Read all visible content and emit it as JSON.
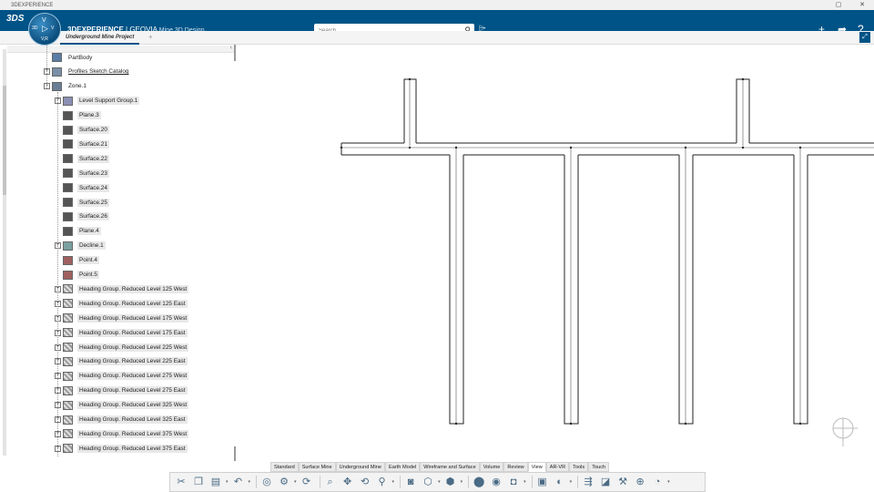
{
  "window": {
    "title": "3DEXPERIENCE"
  },
  "appbar": {
    "brand": "3DEXPERIENCE",
    "app": "GEOVIA",
    "app_sub": "Mine 3D Design",
    "compass": {
      "top": "V",
      "left": "3D",
      "right": "V",
      "bottom": "V,R"
    },
    "search_placeholder": "Search"
  },
  "tabs": {
    "project": "Underground Mine Project"
  },
  "tree": [
    {
      "label": "PartBody",
      "indent": 1
    },
    {
      "label": "Profiles Sketch Catalog",
      "indent": 1
    },
    {
      "label": "Zone.1",
      "indent": 1
    },
    {
      "label": "Level Support Group.1",
      "indent": 2
    },
    {
      "label": "Plane.3",
      "indent": 2
    },
    {
      "label": "Surface.20",
      "indent": 2
    },
    {
      "label": "Surface.21",
      "indent": 2
    },
    {
      "label": "Surface.22",
      "indent": 2
    },
    {
      "label": "Surface.23",
      "indent": 2
    },
    {
      "label": "Surface.24",
      "indent": 2
    },
    {
      "label": "Surface.25",
      "indent": 2
    },
    {
      "label": "Surface.26",
      "indent": 2
    },
    {
      "label": "Plane.4",
      "indent": 2
    },
    {
      "label": "Decline.1",
      "indent": 2
    },
    {
      "label": "Point.4",
      "indent": 2
    },
    {
      "label": "Point.5",
      "indent": 2
    },
    {
      "label": "Heading Group. Reduced Level 125 West",
      "indent": 2
    },
    {
      "label": "Heading Group. Reduced Level 125 East",
      "indent": 2
    },
    {
      "label": "Heading Group. Reduced Level 175 West",
      "indent": 2
    },
    {
      "label": "Heading Group. Reduced Level 175 East",
      "indent": 2
    },
    {
      "label": "Heading Group. Reduced Level 225 West",
      "indent": 2
    },
    {
      "label": "Heading Group. Reduced Level 225 East",
      "indent": 2
    },
    {
      "label": "Heading Group. Reduced Level 275 West",
      "indent": 2
    },
    {
      "label": "Heading Group. Reduced Level 275 East",
      "indent": 2
    },
    {
      "label": "Heading Group. Reduced Level 325 West",
      "indent": 2
    },
    {
      "label": "Heading Group. Reduced Level 325 East",
      "indent": 2
    },
    {
      "label": "Heading Group. Reduced Level 375 West",
      "indent": 2
    },
    {
      "label": "Heading Group. Reduced Level 375 East",
      "indent": 2
    }
  ],
  "command_tabs": [
    "Standard",
    "Surface Mine",
    "Underground Mine",
    "Earth Model",
    "Wireframe and Surface",
    "Volume",
    "Review",
    "View",
    "AR-VR",
    "Tools",
    "Touch"
  ],
  "active_command_tab": "View"
}
